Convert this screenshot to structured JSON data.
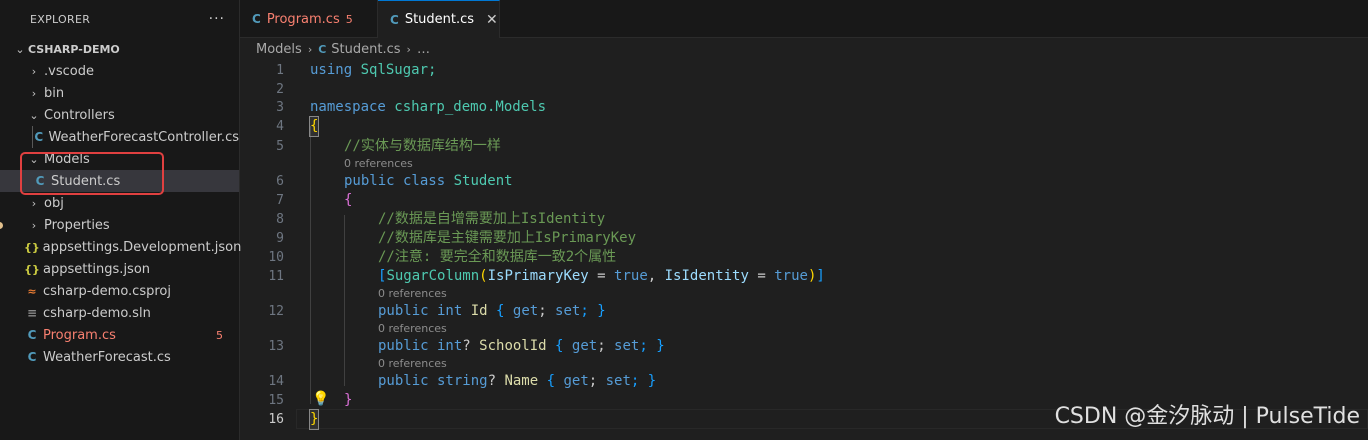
{
  "sidebar": {
    "title": "EXPLORER",
    "more": "···",
    "project": "CSHARP-DEMO",
    "items": [
      {
        "label": ".vscode",
        "chevron": "›"
      },
      {
        "label": "bin",
        "chevron": "›"
      },
      {
        "label": "Controllers",
        "chevron": "⌄"
      },
      {
        "label": "WeatherForecastController.cs",
        "icon": "C"
      },
      {
        "label": "Models",
        "chevron": "⌄"
      },
      {
        "label": "Student.cs",
        "icon": "C"
      },
      {
        "label": "obj",
        "chevron": "›"
      },
      {
        "label": "Properties",
        "chevron": "›"
      },
      {
        "label": "appsettings.Development.json",
        "icon": "{}"
      },
      {
        "label": "appsettings.json",
        "icon": "{}"
      },
      {
        "label": "csharp-demo.csproj",
        "icon": "≈"
      },
      {
        "label": "csharp-demo.sln",
        "icon": "≡"
      },
      {
        "label": "Program.cs",
        "icon": "C",
        "badge": "5"
      },
      {
        "label": "WeatherForecast.cs",
        "icon": "C"
      }
    ]
  },
  "tabs": [
    {
      "label": "Program.cs",
      "count": "5"
    },
    {
      "label": "Student.cs",
      "close": "✕"
    }
  ],
  "breadcrumb": {
    "folder": "Models",
    "file": "Student.cs",
    "more": "…",
    "sep": "›"
  },
  "editor": {
    "line_numbers": [
      "1",
      "2",
      "3",
      "4",
      "5",
      "6",
      "7",
      "8",
      "9",
      "10",
      "11",
      "12",
      "13",
      "14",
      "15",
      "16"
    ],
    "codelens": "0 references",
    "code": {
      "l1": [
        "using",
        " SqlSugar;"
      ],
      "l3": [
        "namespace",
        " csharp_demo.Models"
      ],
      "l4": "{",
      "l5": "//实体与数据库结构一样",
      "l6": [
        "public",
        " class",
        " Student"
      ],
      "l7": "{",
      "l8": "//数据是自增需要加上IsIdentity",
      "l9": "//数据库是主键需要加上IsPrimaryKey",
      "l10": "//注意: 要完全和数据库一致2个属性",
      "l11": [
        "[",
        "SugarColumn",
        "(",
        "IsPrimaryKey",
        " = ",
        "true",
        ", ",
        "IsIdentity",
        " = ",
        "true",
        ")",
        "]"
      ],
      "l12": [
        "public",
        " int",
        " Id",
        " { ",
        "get",
        "; ",
        "set",
        "; }"
      ],
      "l13": [
        "public",
        " int",
        "? ",
        "SchoolId",
        " { ",
        "get",
        "; ",
        "set",
        "; }"
      ],
      "l14": [
        "public",
        " string",
        "? ",
        "Name",
        " { ",
        "get",
        "; ",
        "set",
        "; }"
      ],
      "l15": "}",
      "l16": "}"
    }
  },
  "watermark": "CSDN @金汐脉动 | PulseTide"
}
